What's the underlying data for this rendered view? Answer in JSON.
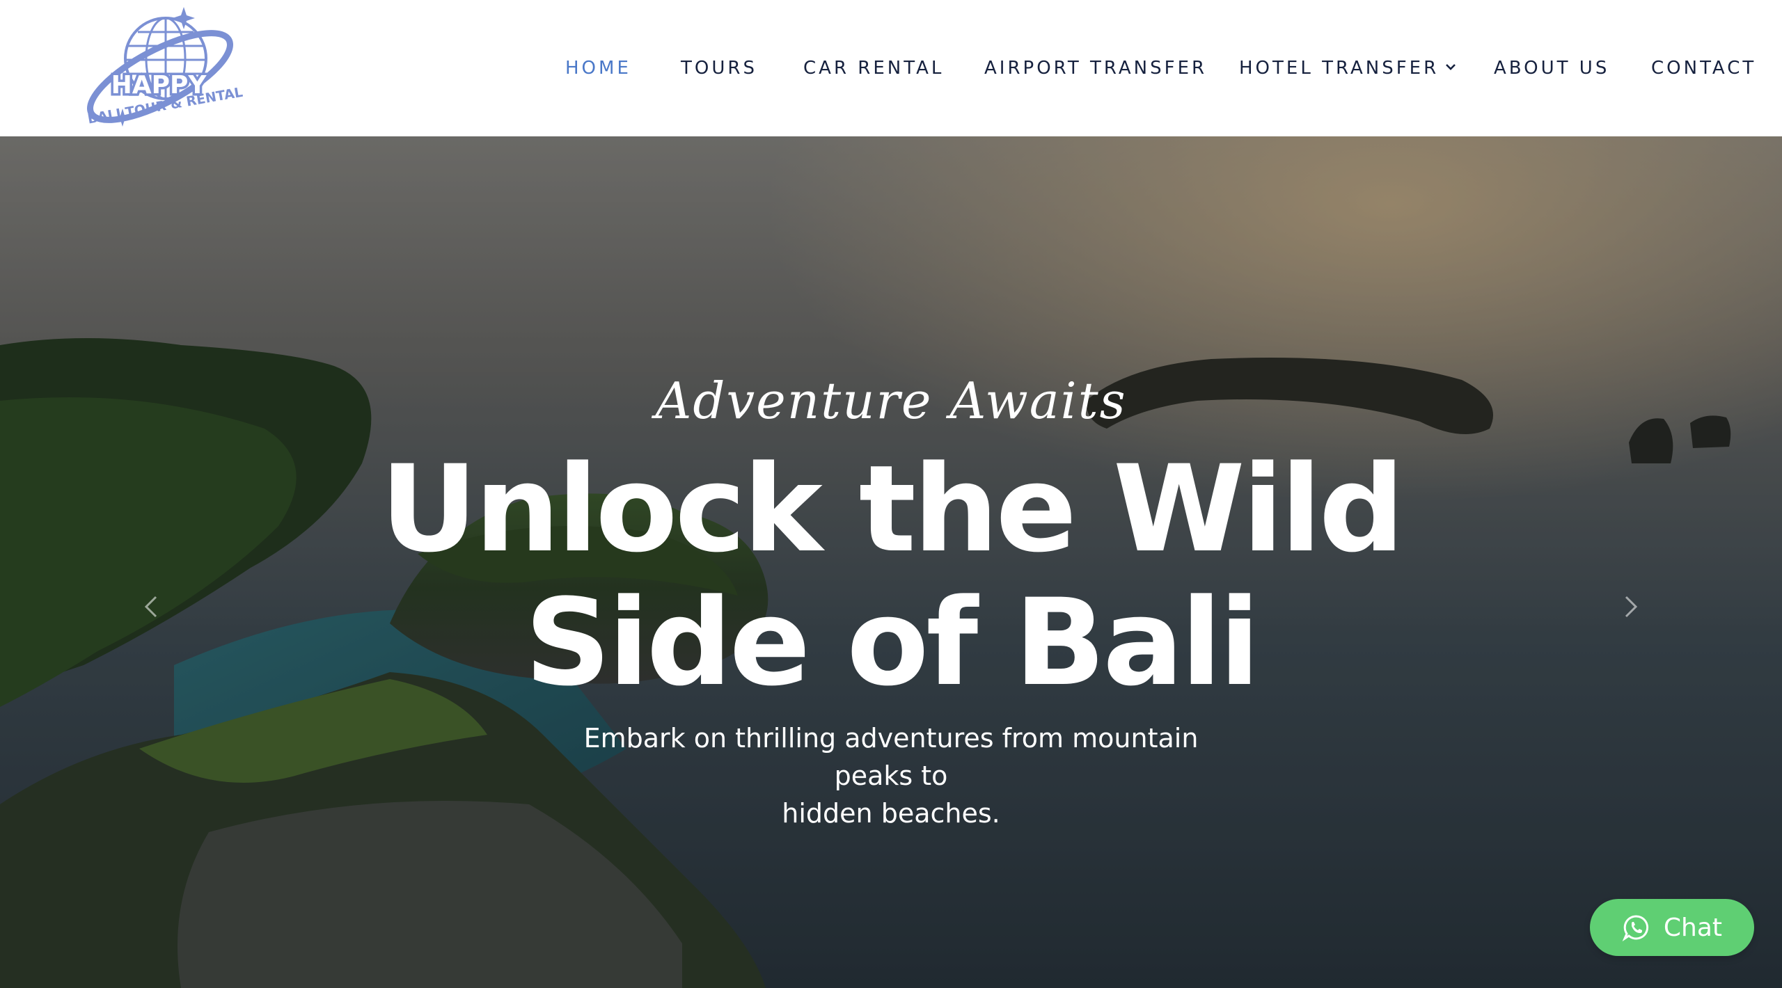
{
  "logo": {
    "line1": "HAPPY",
    "line2": "BALI TOUR & RENTAL"
  },
  "nav": {
    "items": [
      {
        "label": "HOME",
        "active": true
      },
      {
        "label": "TOURS"
      },
      {
        "label": "CAR RENTAL"
      },
      {
        "label": "AIRPORT TRANSFER"
      },
      {
        "label": "HOTEL TRANSFER",
        "has_dropdown": true
      },
      {
        "label": "ABOUT US"
      },
      {
        "label": "CONTACT"
      }
    ]
  },
  "hero": {
    "tagline": "Adventure Awaits",
    "headline_line1": "Unlock the Wild",
    "headline_line2": "Side of Bali",
    "subtitle_line1": "Embark on thrilling adventures from mountain peaks to",
    "subtitle_line2": "hidden beaches.",
    "prev_icon": "chevron-left-icon",
    "next_icon": "chevron-right-icon"
  },
  "chat": {
    "label": "Chat",
    "icon": "whatsapp-icon"
  },
  "colors": {
    "accent": "#4a78c8",
    "nav_text": "#16213e",
    "chat_green": "#5fcf73",
    "logo_blue": "#7b90d4"
  }
}
